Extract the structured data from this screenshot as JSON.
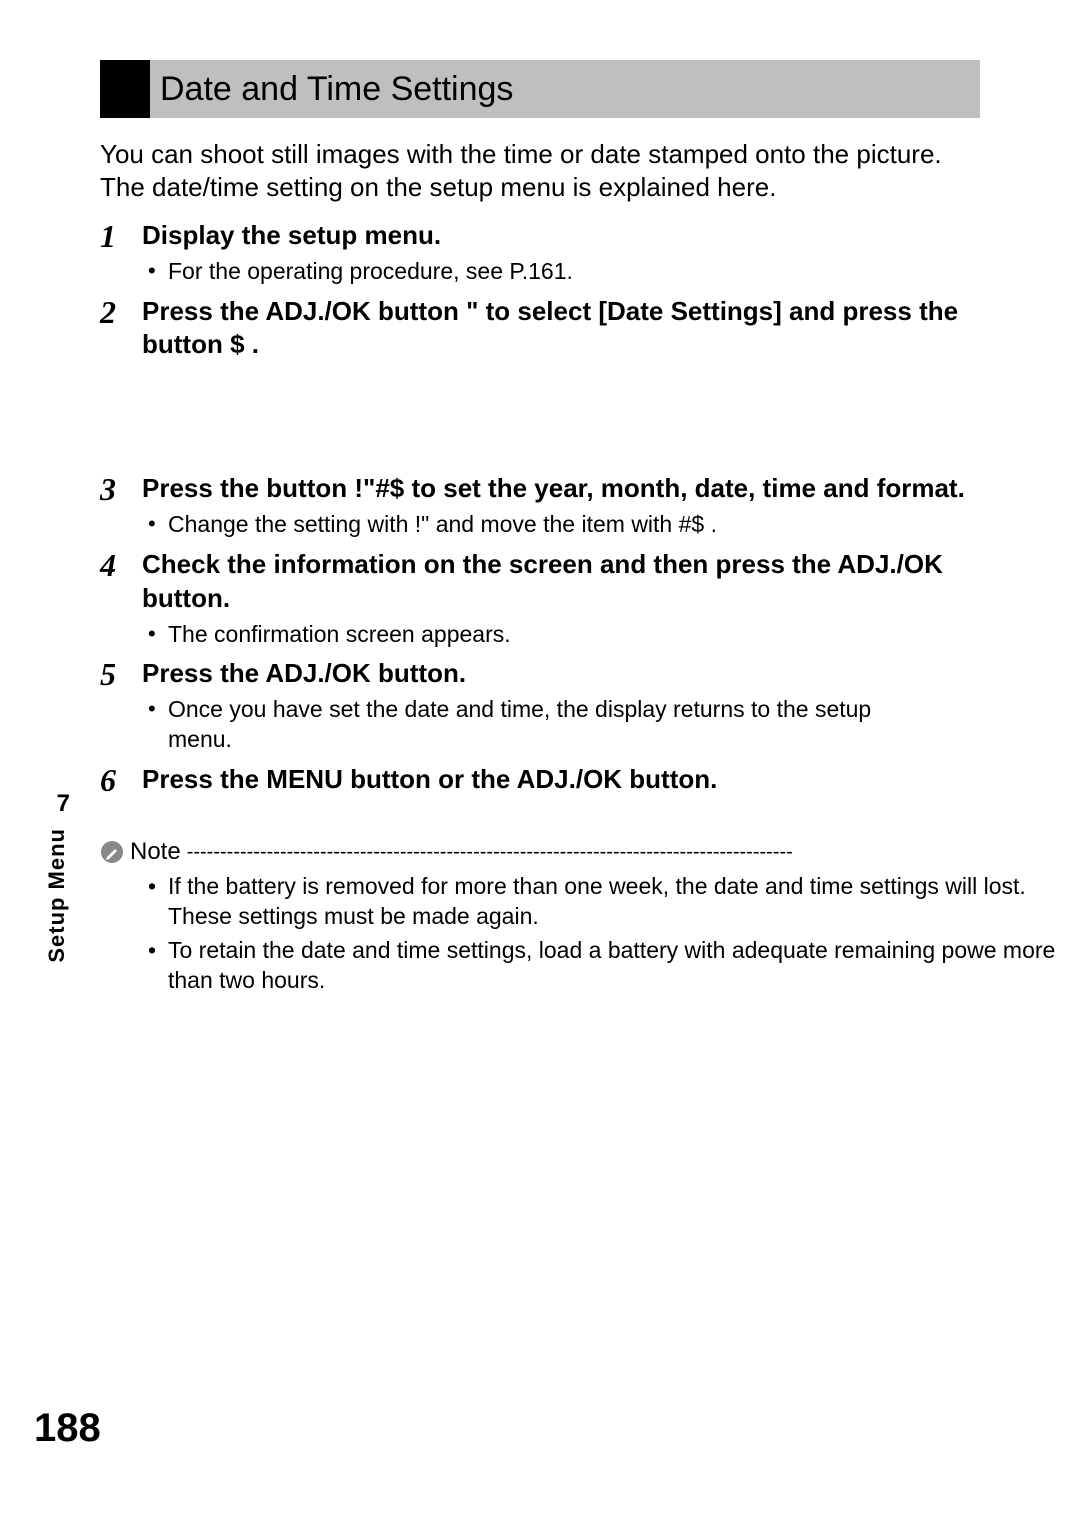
{
  "title": "Date and Time Settings",
  "intro_1": "You can shoot still images with the time or date stamped onto the picture.",
  "intro_2": "The date/time setting on the setup menu is explained here.",
  "steps": {
    "s1": {
      "num": "1",
      "title": "Display the setup menu.",
      "sub1": "For the operating procedure, see P.161."
    },
    "s2": {
      "num": "2",
      "title": "Press the ADJ./OK button \"   to select [Date Settings] and press the button $ ."
    },
    "s3": {
      "num": "3",
      "title": "Press the button !\"#$       to set the year, month, date, time and format.",
      "sub1": "Change the setting with !\"     and move the item with #$  ."
    },
    "s4": {
      "num": "4",
      "title": "Check the information on the screen and then press the ADJ./OK button.",
      "sub1": "The confirmation screen appears."
    },
    "s5": {
      "num": "5",
      "title": "Press the ADJ./OK button.",
      "sub1": "Once you have set the date and time, the display returns to the setup menu."
    },
    "s6": {
      "num": "6",
      "title": "Press the MENU button or the ADJ./OK button."
    }
  },
  "note_label": "Note",
  "note_dashes": "-------------------------------------------------------------------------------------------",
  "notes": {
    "n1": "If the battery is removed for more than one week, the date and time settings will lost. These settings must be made again.",
    "n2": "To retain the date and time settings, load a battery with adequate remaining powe more than two hours."
  },
  "side": {
    "chapter": "7",
    "label": "Setup Menu"
  },
  "page_number": "188"
}
